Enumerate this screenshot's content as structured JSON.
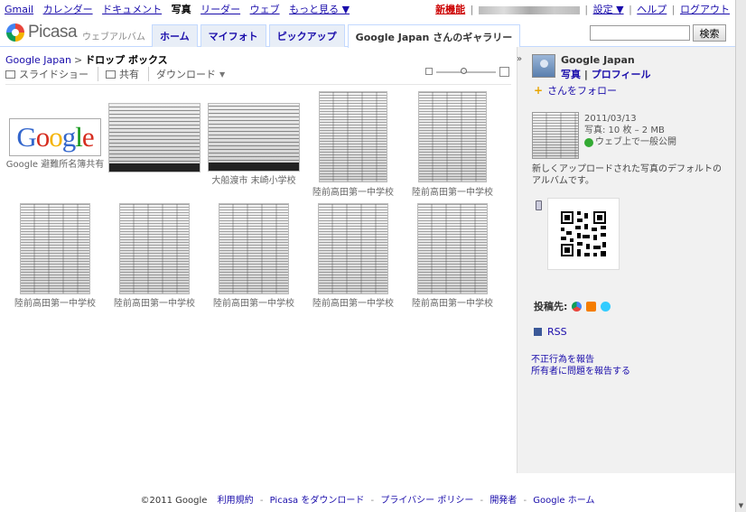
{
  "gbar": {
    "left": [
      {
        "label": "Gmail",
        "current": false
      },
      {
        "label": "カレンダー",
        "current": false
      },
      {
        "label": "ドキュメント",
        "current": false
      },
      {
        "label": "写真",
        "current": true
      },
      {
        "label": "リーダー",
        "current": false
      },
      {
        "label": "ウェブ",
        "current": false
      },
      {
        "label": "もっと見る ▼",
        "current": false
      }
    ],
    "new_feature": "新機能",
    "settings": "設定 ▼",
    "help": "ヘルプ",
    "logout": "ログアウト"
  },
  "header": {
    "logo_text": "Picasa",
    "logo_sub": "ウェブアルバム",
    "tabs": [
      "ホーム",
      "マイフォト",
      "ピックアップ",
      "Google Japan さんのギャラリー"
    ],
    "active_tab": 3,
    "search_button": "検索",
    "search_value": ""
  },
  "breadcrumb": {
    "owner": "Google Japan",
    "separator": ">",
    "album": "ドロップ ボックス"
  },
  "toolbar": {
    "slideshow": "スライドショー",
    "share": "共有",
    "download": "ダウンロード",
    "zoom_level": 0.4
  },
  "photos": [
    {
      "caption": "Google 避難所名簿共有",
      "kind": "logo"
    },
    {
      "caption": "",
      "kind": "doc"
    },
    {
      "caption": "大船渡市 末崎小学校",
      "kind": "doc"
    },
    {
      "caption": "陸前高田第一中学校",
      "kind": "sheet"
    },
    {
      "caption": "陸前高田第一中学校",
      "kind": "sheet"
    },
    {
      "caption": "陸前高田第一中学校",
      "kind": "sheet"
    },
    {
      "caption": "陸前高田第一中学校",
      "kind": "sheet"
    },
    {
      "caption": "陸前高田第一中学校",
      "kind": "sheet"
    },
    {
      "caption": "陸前高田第一中学校",
      "kind": "sheet"
    },
    {
      "caption": "陸前高田第一中学校",
      "kind": "sheet"
    }
  ],
  "logo_letters": [
    "G",
    "o",
    "o",
    "g",
    "l",
    "e"
  ],
  "side": {
    "owner_name": "Google Japan",
    "photos_link": "写真",
    "profile_link": "プロフィール",
    "follow": "さんをフォロー",
    "date": "2011/03/13",
    "stats": "写真: 10 枚 – 2 MB",
    "visibility": "ウェブ上で一般公開",
    "description": "新しくアップロードされた写真のデフォルトのアルバムです。",
    "share_label": "投稿先:",
    "rss": "RSS",
    "report_abuse": "不正行為を報告",
    "report_owner": "所有者に問題を報告する"
  },
  "footer": {
    "copyright": "©2011 Google",
    "links": [
      "利用規約",
      "Picasa をダウンロード",
      "プライバシー ポリシー",
      "開発者",
      "Google ホーム"
    ]
  },
  "icons": {
    "slideshow": "slideshow-icon",
    "share": "mail-icon",
    "download_caret": "chevron-down-icon",
    "collapse": "double-chevron-right-icon",
    "follow": "add-person-icon",
    "visibility": "globe-icon",
    "phone": "mobile-phone-icon",
    "qr": "qr-code",
    "buzz": "buzz-icon",
    "blogger": "blogger-icon",
    "twitter": "twitter-icon",
    "rss": "rss-icon"
  }
}
